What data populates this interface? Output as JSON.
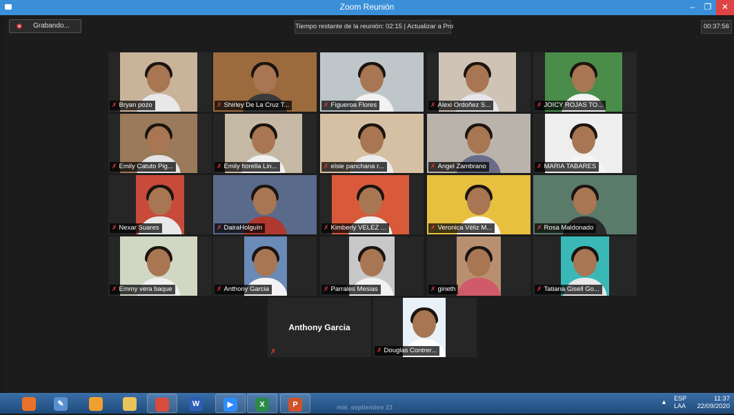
{
  "window": {
    "title": "Zoom Reunión",
    "minimize": "–",
    "maximize": "❐",
    "close": "✕"
  },
  "toolbar": {
    "recording_label": "Grabando...",
    "time_banner": "Tiempo restante de la reunión: 02:15 | Actualizar a Pro",
    "elapsed": "00:37:56"
  },
  "participants": [
    {
      "name": "Bryan pozo",
      "muted": true,
      "active": false,
      "video": true
    },
    {
      "name": "Shirley De La Cruz T...",
      "muted": true,
      "active": true,
      "video": true
    },
    {
      "name": "Figueroa Flores",
      "muted": true,
      "active": false,
      "video": true
    },
    {
      "name": "Alexi Ordoñez S...",
      "muted": true,
      "active": false,
      "video": true
    },
    {
      "name": "JOICY ROJAS TO...",
      "muted": true,
      "active": false,
      "video": true
    },
    {
      "name": "Emily Catuto Pig...",
      "muted": true,
      "active": false,
      "video": true
    },
    {
      "name": "Emily fiorella Lin...",
      "muted": true,
      "active": false,
      "video": true
    },
    {
      "name": "elsie panchana r...",
      "muted": true,
      "active": false,
      "video": true
    },
    {
      "name": "Angel Zambrano",
      "muted": true,
      "active": false,
      "video": true
    },
    {
      "name": "MARIA TABARES",
      "muted": true,
      "active": false,
      "video": true
    },
    {
      "name": "Nexar Suares",
      "muted": true,
      "active": false,
      "video": true
    },
    {
      "name": "DairaHolguín",
      "muted": true,
      "active": false,
      "video": true
    },
    {
      "name": "Kimberly VELEZ ...",
      "muted": true,
      "active": false,
      "video": true
    },
    {
      "name": "Veronica Véliz M...",
      "muted": true,
      "active": false,
      "video": true
    },
    {
      "name": "Rosa Maldonado",
      "muted": true,
      "active": false,
      "video": true
    },
    {
      "name": "Emmy vera baque",
      "muted": true,
      "active": false,
      "video": true
    },
    {
      "name": "Anthony Garcia",
      "muted": true,
      "active": false,
      "video": true
    },
    {
      "name": "Parrales Mesias",
      "muted": true,
      "active": false,
      "video": true
    },
    {
      "name": "gineth",
      "muted": true,
      "active": false,
      "video": true
    },
    {
      "name": "Tatiana Gisell Go...",
      "muted": true,
      "active": false,
      "video": true
    },
    {
      "name": "Anthony Garcia",
      "muted": true,
      "active": false,
      "video": false
    },
    {
      "name": "Douglas Contrer...",
      "muted": true,
      "active": false,
      "video": true
    }
  ],
  "taskbar": {
    "apps": [
      {
        "name": "firefox",
        "glyph": "",
        "color": "#e8722a"
      },
      {
        "name": "paint",
        "glyph": "✎",
        "color": "#5a8fd0"
      },
      {
        "name": "browser",
        "glyph": "",
        "color": "#f0a030"
      },
      {
        "name": "explorer",
        "glyph": "",
        "color": "#e8c35a"
      },
      {
        "name": "chrome",
        "glyph": "",
        "color": "#d94b3a"
      },
      {
        "name": "word",
        "glyph": "W",
        "color": "#2b5fb5"
      },
      {
        "name": "zoom",
        "glyph": "▶",
        "color": "#2d8cff"
      },
      {
        "name": "excel",
        "glyph": "X",
        "color": "#2a8a4a"
      },
      {
        "name": "powerpoint",
        "glyph": "P",
        "color": "#d0522a"
      }
    ],
    "ghost_text": "mié. septiembre 23",
    "lang_code": "ESP",
    "lang_layout": "LAA",
    "time": "11:37",
    "date": "22/09/2020"
  }
}
